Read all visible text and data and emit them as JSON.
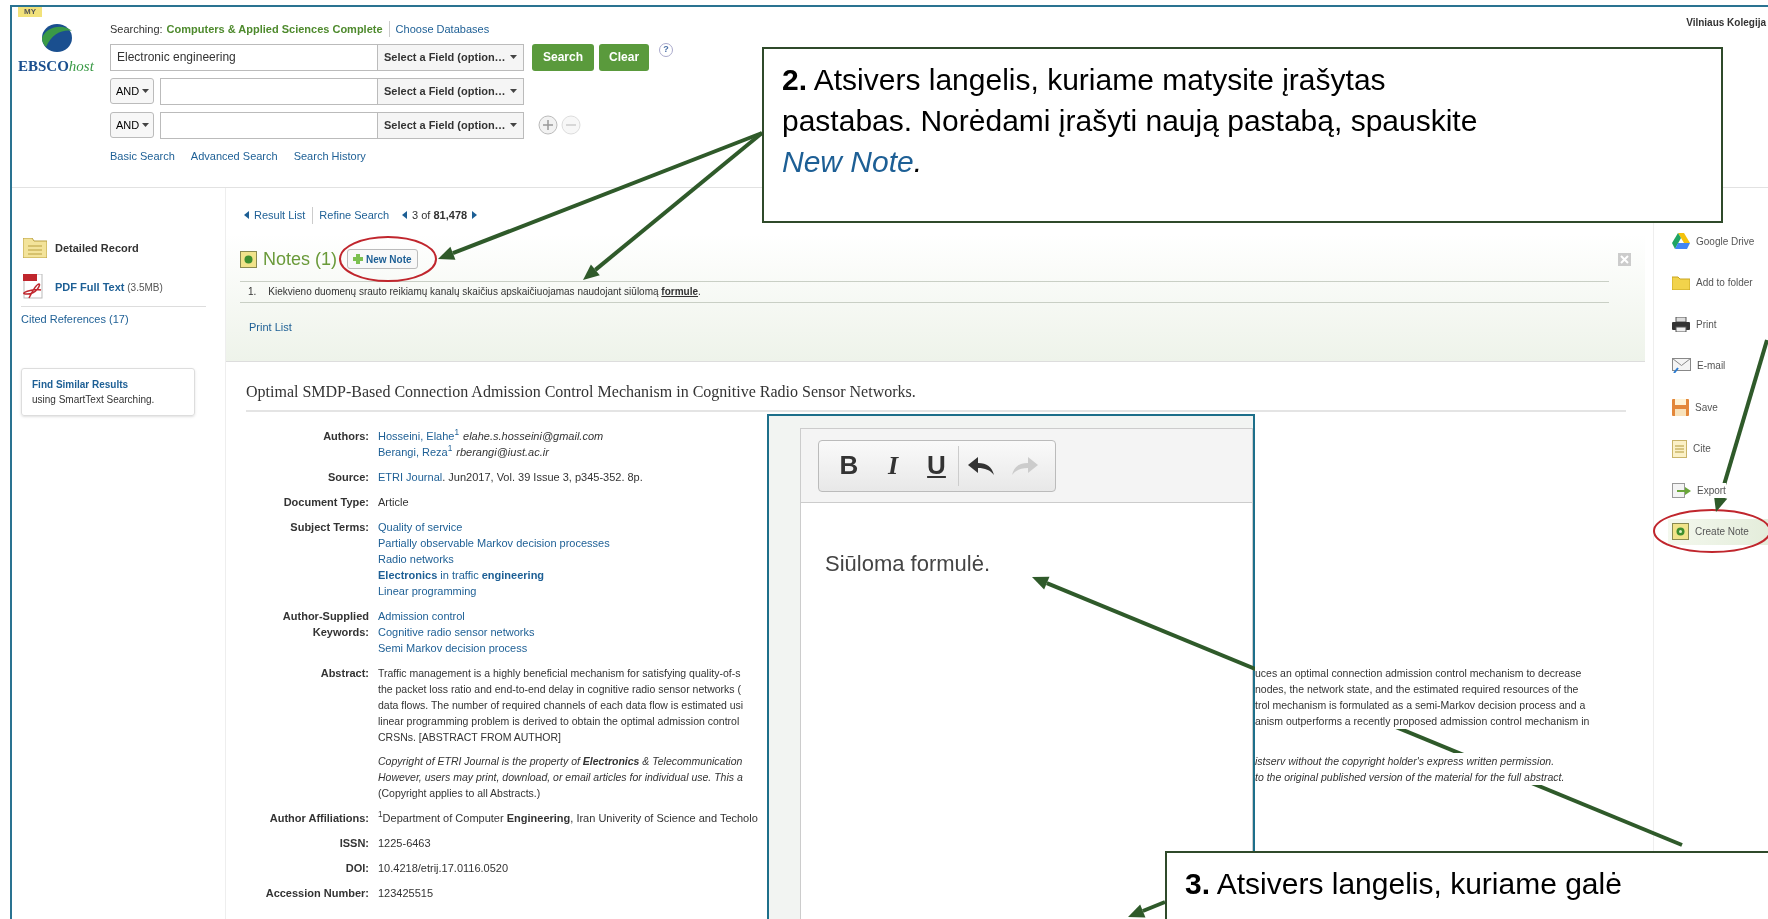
{
  "header": {
    "badge": "MY",
    "logo_text": "EBSCO",
    "logo_text_italic": "host",
    "searching_label": "Searching:",
    "database": "Computers & Applied Sciences Complete",
    "choose_databases": "Choose Databases",
    "institution": "Vilniaus Kolegija",
    "search_rows": [
      {
        "kind": "first",
        "value": "Electronic engineering",
        "field": "Select a Field (option…"
      },
      {
        "kind": "boolean",
        "operator": "AND",
        "field": "Select a Field (option…"
      },
      {
        "kind": "boolean",
        "operator": "AND",
        "field": "Select a Field (option…"
      }
    ],
    "search_button": "Search",
    "clear_button": "Clear",
    "help": "?",
    "links": [
      "Basic Search",
      "Advanced Search",
      "Search History"
    ]
  },
  "sidebar": {
    "items": [
      {
        "kind": "record",
        "label": "Detailed Record"
      },
      {
        "kind": "pdf",
        "label": "PDF Full Text",
        "size": "(3.5MB)"
      }
    ],
    "cited": "Cited References (17)",
    "find_similar": {
      "title": "Find Similar Results",
      "subtitle": "using SmartText Searching."
    }
  },
  "nav": {
    "result_list": "Result List",
    "refine_search": "Refine Search",
    "position": "3 of **81,478**"
  },
  "notes": {
    "title": "Notes (1)",
    "new_note": "New Note",
    "items": [
      {
        "number": "1.",
        "text": "Kiekvieno duomenų srauto reikiamų kanalų skaičius apskaičiuojamas naudojant siūlomą **formule**."
      }
    ],
    "print_list": "Print List"
  },
  "record": {
    "title": "Optimal SMDP-Based Connection Admission Control Mechanism in Cognitive Radio Sensor Networks.",
    "fields": [
      {
        "label": "Authors:",
        "lines": [
          [
            {
              "kind": "link",
              "text": "Hosseini, Elahe$^{1}$"
            },
            {
              "kind": "email",
              "text": "elahe.s.hosseini@gmail.com"
            }
          ],
          [
            {
              "kind": "link",
              "text": "Berangi, Reza$^{1}$"
            },
            {
              "kind": "email",
              "text": "rberangi@iust.ac.ir"
            }
          ]
        ]
      },
      {
        "label": "Source:",
        "lines": [
          [
            {
              "kind": "link",
              "text": "ETRI Journal"
            },
            {
              "kind": "text",
              "text": ". Jun2017, Vol. 39 Issue 3, p345-352. 8p."
            }
          ]
        ]
      },
      {
        "label": "Document Type:",
        "lines": [
          [
            {
              "kind": "text",
              "text": "Article"
            }
          ]
        ]
      },
      {
        "label": "Subject Terms:",
        "lines": [
          [
            {
              "kind": "link",
              "text": "Quality of service"
            }
          ],
          [
            {
              "kind": "link",
              "text": "Partially observable Markov decision processes"
            }
          ],
          [
            {
              "kind": "link",
              "text": "Radio networks"
            }
          ],
          [
            {
              "kind": "link",
              "text": "**Electronics** in traffic **engineering**"
            }
          ],
          [
            {
              "kind": "link",
              "text": "Linear programming"
            }
          ]
        ]
      },
      {
        "label": "Author-Supplied Keywords:",
        "lines": [
          [
            {
              "kind": "link",
              "text": "Admission control"
            }
          ],
          [
            {
              "kind": "link",
              "text": "Cognitive radio sensor networks"
            }
          ],
          [
            {
              "kind": "link",
              "text": "Semi Markov decision process"
            }
          ]
        ]
      },
      {
        "label": "Abstract:",
        "paragraphs": [
          {
            "kind": "abstract",
            "lines": [
              {
                "left": "Traffic management is a highly beneficial mechanism for satisfying quality-of-s",
                "right": "uces an optimal connection admission control mechanism to decrease"
              },
              {
                "left": "the packet loss ratio and end-to-end delay in cognitive radio sensor networks (",
                "right": "nodes, the network state, and the estimated required resources of the"
              },
              {
                "left": "data flows. The number of required channels of each data flow is estimated usi",
                "right": "trol mechanism is formulated as a semi-Markov decision process and a"
              },
              {
                "left": "linear programming problem is derived to obtain the optimal admission control",
                "right": "anism outperforms a recently proposed admission control mechanism in"
              },
              {
                "left": "CRSNs. [ABSTRACT FROM AUTHOR]"
              }
            ]
          },
          {
            "kind": "copyright",
            "lines": [
              {
                "left": "Copyright of ETRI Journal is the property of **Electronics** & Telecommunication",
                "right": "istserv without the copyright holder's express written permission."
              },
              {
                "left": "However, users may print, download, or email articles for individual use. This a",
                "right": "to the original published version of the material for the full abstract."
              }
            ]
          },
          {
            "kind": "note",
            "lines": [
              {
                "left": "(Copyright applies to all Abstracts.)"
              }
            ]
          }
        ]
      },
      {
        "label": "Author Affiliations:",
        "lines": [
          [
            {
              "kind": "text",
              "text": "$^{1}$Department of Computer **Engineering**, Iran Univerity of Science and Techolo"
            }
          ]
        ]
      },
      {
        "label": "ISSN:",
        "lines": [
          [
            {
              "kind": "text",
              "text": "1225-6463"
            }
          ]
        ]
      },
      {
        "label": "DOI:",
        "lines": [
          [
            {
              "kind": "text",
              "text": "10.4218/etrij.17.0116.0520"
            }
          ]
        ]
      },
      {
        "label": "Accession Number:",
        "lines": [
          [
            {
              "kind": "text",
              "text": "123425515"
            }
          ]
        ]
      }
    ]
  },
  "tools": [
    {
      "kind": "drive",
      "label": "Google Drive",
      "selected": false
    },
    {
      "kind": "folder",
      "label": "Add to folder",
      "selected": false
    },
    {
      "kind": "print",
      "label": "Print",
      "selected": false
    },
    {
      "kind": "email",
      "label": "E-mail",
      "selected": false
    },
    {
      "kind": "save",
      "label": "Save",
      "selected": false
    },
    {
      "kind": "cite",
      "label": "Cite",
      "selected": false
    },
    {
      "kind": "export",
      "label": "Export",
      "selected": false
    },
    {
      "kind": "note",
      "label": "Create Note",
      "selected": true
    }
  ],
  "editor": {
    "toolbar": [
      {
        "kind": "bold",
        "label": "B",
        "disabled": false
      },
      {
        "kind": "italic",
        "label": "I",
        "disabled": false
      },
      {
        "kind": "underline",
        "label": "U",
        "disabled": false
      },
      {
        "kind": "undo",
        "disabled": false
      },
      {
        "kind": "redo",
        "disabled": true
      }
    ],
    "content": "Siūloma formulė."
  },
  "callouts": [
    {
      "number": "2.",
      "text": "Atsivers langelis, kuriame matysite įrašytas pastabas. Norėdami įrašyti naują pastabą, spauskite",
      "link": "New Note",
      "tail": "."
    },
    {
      "number": "3.",
      "text": "Atsivers langelis, kuriame galė"
    }
  ]
}
